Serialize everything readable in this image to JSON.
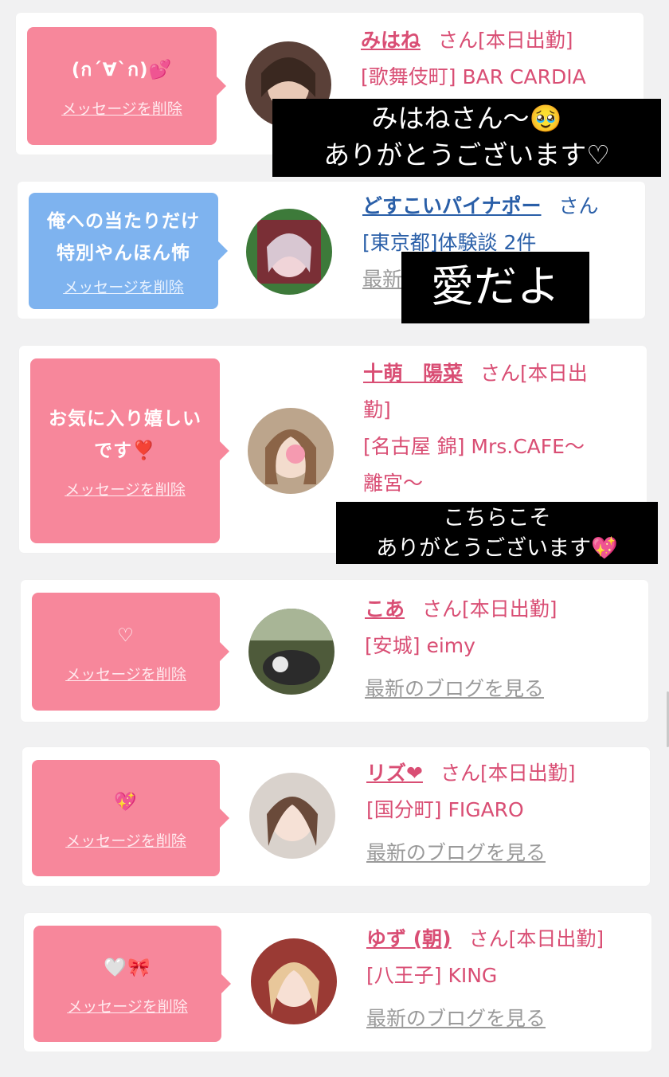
{
  "messages": [
    {
      "bubble_text": "(ก´∀`ก)💕",
      "delete_label": "メッセージを削除",
      "name": "みはね",
      "san": "さん[本日出勤]",
      "shop": "[歌舞伎町] BAR CARDIA",
      "blog": ""
    },
    {
      "bubble_text": "俺への当たりだけ\n特別やんほん怖",
      "delete_label": "メッセージを削除",
      "name": "どすこいパイナポー",
      "san": "さん",
      "shop": "[東京都]体験談 2件",
      "blog": "最新"
    },
    {
      "bubble_text": "お気に入り嬉しい\nです❣️",
      "delete_label": "メッセージを削除",
      "name": "十萌　陽菜",
      "san": "さん[本日出",
      "name_line2": "勤]",
      "shop": "[名古屋 錦] Mrs.CAFE〜",
      "shop_line2": "離宮〜",
      "blog": ""
    },
    {
      "bubble_text": "♡",
      "delete_label": "メッセージを削除",
      "name": "こあ",
      "san": "さん[本日出勤]",
      "shop": "[安城] eimy",
      "blog": "最新のブログを見る"
    },
    {
      "bubble_text": "💖",
      "delete_label": "メッセージを削除",
      "name": "リズ❤",
      "san": "さん[本日出勤]",
      "shop": "[国分町] FIGARO",
      "blog": "最新のブログを見る"
    },
    {
      "bubble_text": "🤍🎀",
      "delete_label": "メッセージを削除",
      "name": "ゆず (朝)",
      "san": "さん[本日出勤]",
      "shop": "[八王子] KING",
      "blog": "最新のブログを見る"
    }
  ],
  "overlays": {
    "first": "みはねさん〜🥹\nありがとうございます♡",
    "second": "愛だよ",
    "third": "こちらこそ\nありがとうございます💖"
  },
  "colors": {
    "pink_bubble": "#f7879b",
    "blue_bubble": "#7eb3ef",
    "name_pink": "#d94e74",
    "name_blue": "#2a5fa8"
  }
}
